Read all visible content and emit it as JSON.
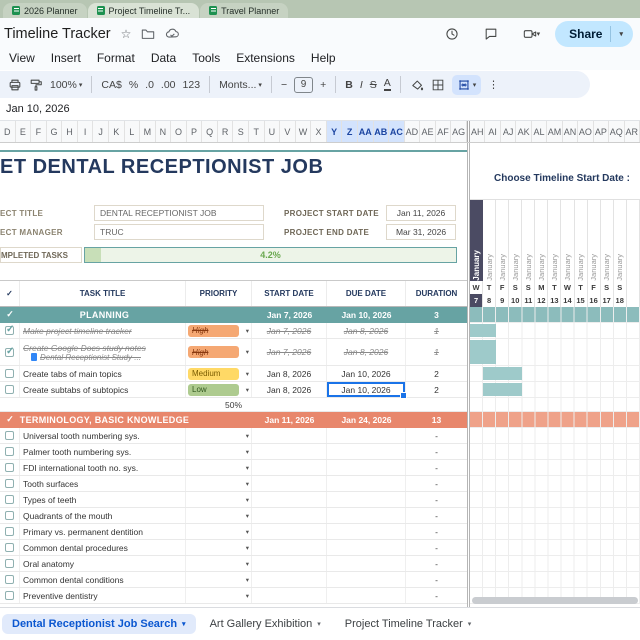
{
  "colors": {
    "accent_teal": "#67A3A3",
    "accent_salmon": "#E8876C",
    "selection_blue": "#1A73E8",
    "share_button_bg": "#C2E7FF",
    "progress_green": "#6AA84F",
    "priority_high_bg": "#F5A873",
    "priority_medium_bg": "#FFD966",
    "priority_low_bg": "#AECB8F",
    "timeline_bar": "#9ECACA",
    "timeline_header_dark": "#4B4B63",
    "title_navy": "#24395E"
  },
  "icons": {
    "caret": "▾",
    "more_vertical": "⋮",
    "check": "✓",
    "star": "☆",
    "minus": "−",
    "plus": "+"
  },
  "browser_tabs": [
    {
      "label": "2026 Planner"
    },
    {
      "label": "Project Timeline Tr..."
    },
    {
      "label": "Travel Planner"
    }
  ],
  "header": {
    "title": "Timeline Tracker",
    "menus": [
      "View",
      "Insert",
      "Format",
      "Data",
      "Tools",
      "Extensions",
      "Help"
    ],
    "share_label": "Share"
  },
  "toolbar": {
    "zoom": "100%",
    "currency": "CA$",
    "percent": "%",
    "decrease_decimal": ".0",
    "increase_decimal": ".00",
    "number_format": "123",
    "font": "Monts...",
    "font_size": "9",
    "bold": "B",
    "italic": "I",
    "strikethrough": "S",
    "text_color": "A"
  },
  "formula_bar": {
    "value": "Jan 10, 2026"
  },
  "column_headers": {
    "left": [
      "D",
      "E",
      "F",
      "G",
      "H",
      "I",
      "J",
      "K",
      "L",
      "M",
      "N",
      "O",
      "P",
      "Q",
      "R",
      "S",
      "T",
      "U",
      "V",
      "W",
      "X",
      "Y",
      "Z",
      "AA",
      "AB",
      "AC",
      "AD",
      "AE",
      "AF",
      "AG"
    ],
    "right": [
      "AH",
      "AI",
      "AJ",
      "AK",
      "AL",
      "AM",
      "AN",
      "AO",
      "AP",
      "AQ",
      "AR"
    ],
    "selected": [
      "Y",
      "Z",
      "AA",
      "AB",
      "AC"
    ]
  },
  "sheet": {
    "title": "ET DENTAL RECEPTIONIST JOB",
    "info": {
      "project_title_label": "ECT TITLE",
      "project_title_value": "DENTAL RECEPTIONIST JOB",
      "project_manager_label": "ECT MANAGER",
      "project_manager_value": "TRUC",
      "project_start_label": "PROJECT START DATE",
      "project_start_value": "Jan 11, 2026",
      "project_end_label": "PROJECT END DATE",
      "project_end_value": "Mar 31, 2026",
      "completed_label": "MPLETED TASKS",
      "completed_value": "4.2%"
    },
    "table_headers": {
      "task": "TASK TITLE",
      "priority": "PRIORITY",
      "start": "START DATE",
      "due": "DUE DATE",
      "duration": "DURATION"
    },
    "rows": [
      {
        "type": "section",
        "color": "teal",
        "title": "PLANNING",
        "start": "Jan 7, 2026",
        "due": "Jan 10, 2026",
        "duration": "3"
      },
      {
        "type": "task",
        "checked": true,
        "done": true,
        "title": "Make project timeline tracker",
        "priority": "High",
        "pclass": "high",
        "start": "Jan 7, 2026",
        "due": "Jan 8, 2026",
        "duration": "1",
        "bar": [
          7,
          8
        ]
      },
      {
        "type": "task",
        "checked": true,
        "done": true,
        "tall": true,
        "title": "Create Google Docs study notes",
        "subtitle": "Dental Receptionist Study ...",
        "priority": "High",
        "pclass": "high",
        "start": "Jan 7, 2026",
        "due": "Jan 8, 2026",
        "duration": "1",
        "bar": [
          7,
          8
        ]
      },
      {
        "type": "task",
        "checked": false,
        "title": "Create tabs of main topics",
        "priority": "Medium",
        "pclass": "medium",
        "start": "Jan 8, 2026",
        "due": "Jan 10, 2026",
        "duration": "2",
        "bar": [
          8,
          10
        ]
      },
      {
        "type": "task",
        "checked": false,
        "title": "Create subtabs of subtopics",
        "priority": "Low",
        "pclass": "low",
        "start": "Jan 8, 2026",
        "due": "Jan 10, 2026",
        "duration": "2",
        "bar": [
          8,
          10
        ],
        "selected_due": true
      },
      {
        "type": "progress",
        "value": "50%"
      },
      {
        "type": "section",
        "color": "salmon",
        "title": "TERMINOLOGY, BASIC KNOWLEDGE",
        "start": "Jan 11, 2026",
        "due": "Jan 24, 2026",
        "duration": "13"
      },
      {
        "type": "task",
        "checked": false,
        "title": "Universal tooth numbering sys.",
        "duration": "-"
      },
      {
        "type": "task",
        "checked": false,
        "title": "Palmer tooth numbering sys.",
        "duration": "-"
      },
      {
        "type": "task",
        "checked": false,
        "title": "FDI international tooth no. sys.",
        "duration": "-"
      },
      {
        "type": "task",
        "checked": false,
        "title": "Tooth surfaces",
        "duration": "-"
      },
      {
        "type": "task",
        "checked": false,
        "title": "Types of teeth",
        "duration": "-"
      },
      {
        "type": "task",
        "checked": false,
        "title": "Quadrants of the mouth",
        "duration": "-"
      },
      {
        "type": "task",
        "checked": false,
        "title": "Primary vs. permanent dentition",
        "duration": "-"
      },
      {
        "type": "task",
        "checked": false,
        "title": "Common dental procedures",
        "duration": "-"
      },
      {
        "type": "task",
        "checked": false,
        "title": "Oral anatomy",
        "duration": "-"
      },
      {
        "type": "task",
        "checked": false,
        "title": "Common dental conditions",
        "duration": "-"
      },
      {
        "type": "task",
        "checked": false,
        "title": "Preventive dentistry",
        "duration": "-"
      }
    ]
  },
  "timeline": {
    "choose_label": "Choose Timeline Start Date :",
    "month": "January",
    "days": [
      {
        "dow": "W",
        "num": "7"
      },
      {
        "dow": "T",
        "num": "8"
      },
      {
        "dow": "F",
        "num": "9"
      },
      {
        "dow": "S",
        "num": "10"
      },
      {
        "dow": "S",
        "num": "11"
      },
      {
        "dow": "M",
        "num": "12"
      },
      {
        "dow": "T",
        "num": "13"
      },
      {
        "dow": "W",
        "num": "14"
      },
      {
        "dow": "T",
        "num": "15"
      },
      {
        "dow": "F",
        "num": "16"
      },
      {
        "dow": "S",
        "num": "17"
      },
      {
        "dow": "S",
        "num": "18"
      }
    ]
  },
  "sheet_tabs": [
    {
      "label": "Dental Receptionist Job Search",
      "active": true
    },
    {
      "label": "Art Gallery Exhibition",
      "active": false
    },
    {
      "label": "Project Timeline Tracker",
      "active": false
    }
  ]
}
